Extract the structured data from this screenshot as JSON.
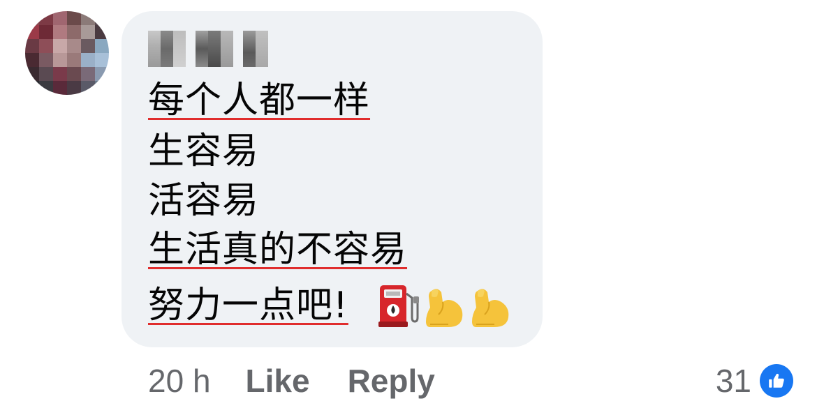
{
  "comment": {
    "lines": [
      "每个人都一样",
      "生容易",
      "活容易",
      "生活真的不容易",
      "努力一点吧!"
    ],
    "emojis": [
      "fuel-pump-emoji",
      "flexed-biceps-emoji",
      "flexed-biceps-emoji"
    ]
  },
  "actions": {
    "time": "20 h",
    "like_label": "Like",
    "reply_label": "Reply"
  },
  "reactions": {
    "count": "31",
    "icon": "thumbs-up-icon"
  },
  "colors": {
    "bubble": "#eff2f5",
    "underline": "#e02d2d",
    "meta_text": "#65676b",
    "like_blue": "#1877f2"
  }
}
